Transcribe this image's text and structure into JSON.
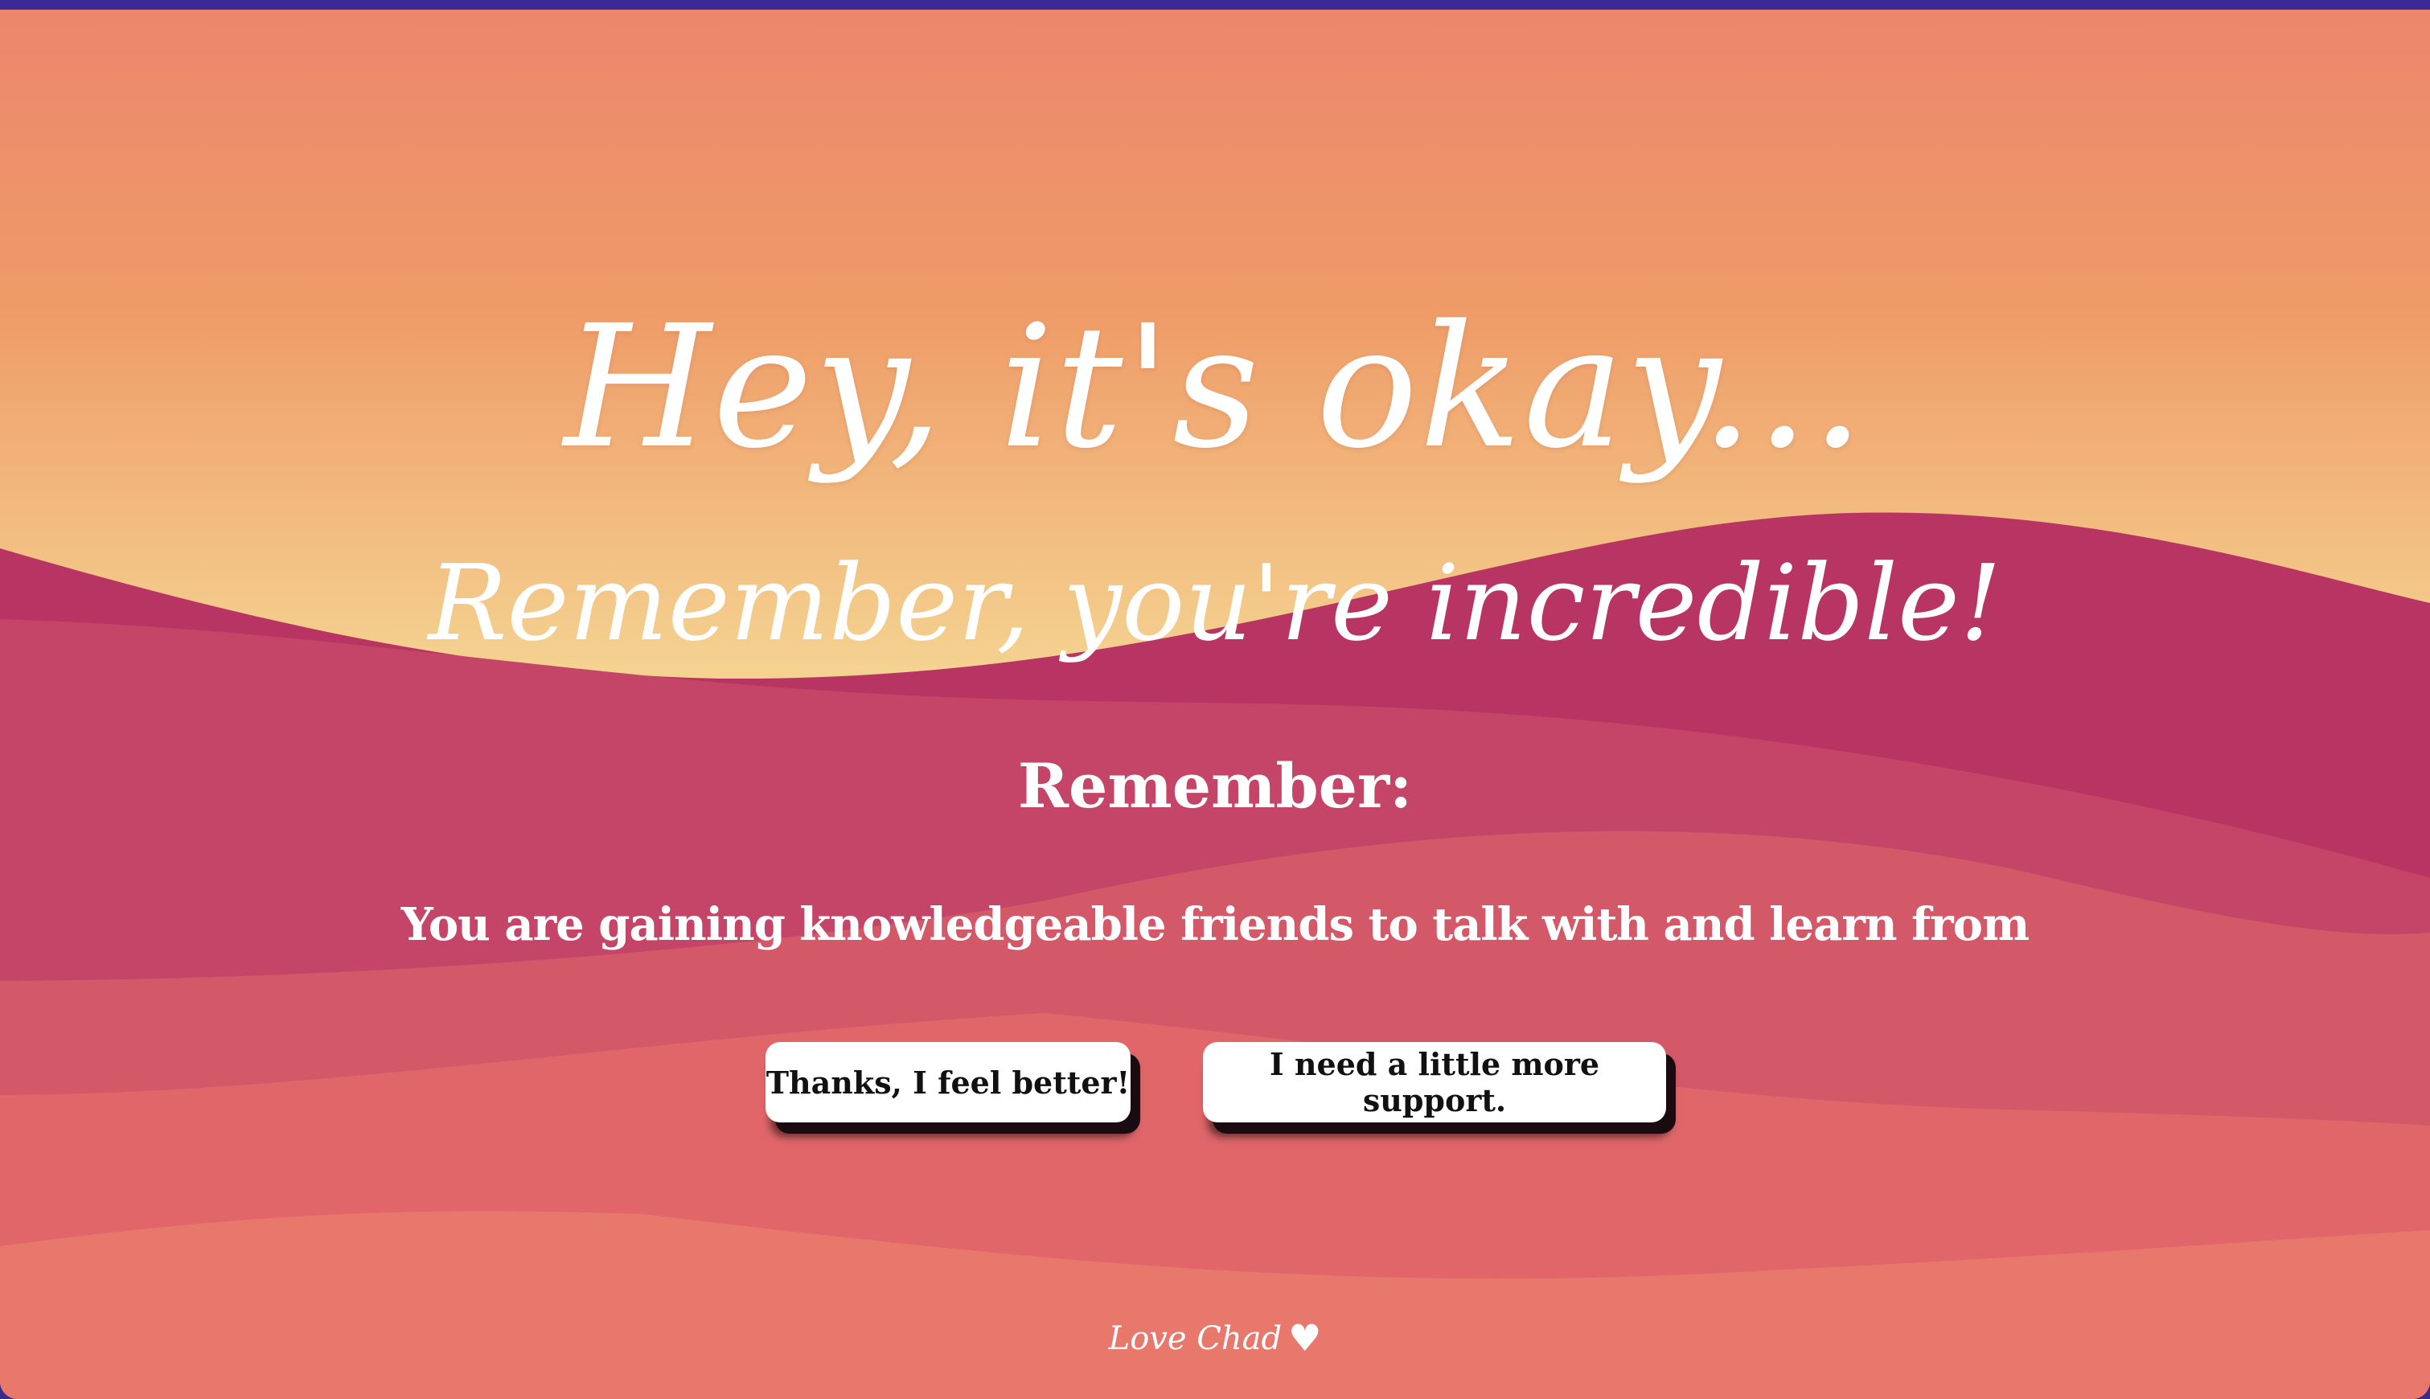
{
  "page": {
    "headline": "Hey, it's okay...",
    "subheadline": "Remember, you're incredible!",
    "remember_label": "Remember:",
    "message": "You are gaining knowledgeable friends to talk with and learn from"
  },
  "actions": {
    "feel_better_label": "Thanks, I feel better!",
    "more_support_label": "I need a little more support."
  },
  "footer": {
    "signature": "Love Chad",
    "heart_glyph": "♥",
    "heart_icon": "heart-icon"
  },
  "colors": {
    "sky_top": "#ec866c",
    "sky_mid": "#ef9c68",
    "sky_bottom": "#f4d391",
    "wave_back": "#b83462",
    "wave_2": "#c44567",
    "wave_3": "#d35868",
    "wave_4": "#e0666a",
    "wave_front": "#e8786c",
    "text": "#ffffff",
    "button_bg": "#ffffff",
    "button_text": "#111111",
    "top_bar": "#3b2a96"
  }
}
